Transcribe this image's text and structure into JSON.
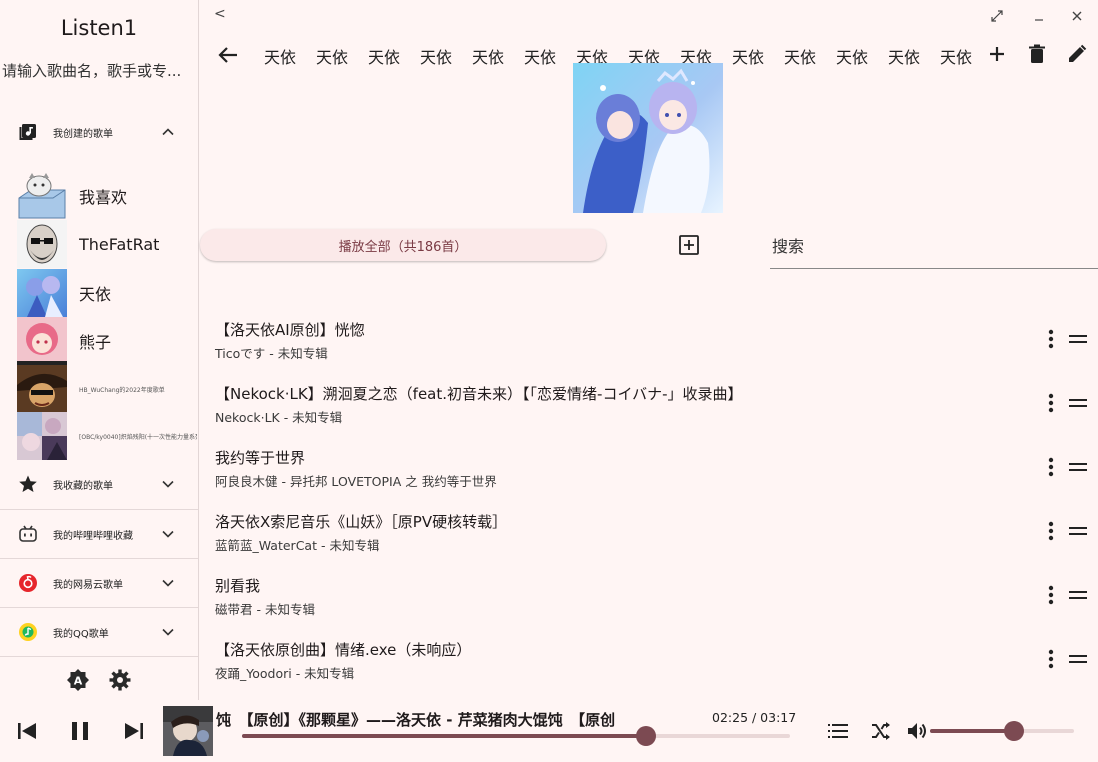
{
  "app": {
    "title": "Listen1"
  },
  "sidebar": {
    "search_placeholder": "请输入歌曲名，歌手或专...",
    "sections": {
      "created": {
        "label": "我创建的歌单",
        "expanded": true
      },
      "favorited": {
        "label": "我收藏的歌单",
        "expanded": false
      },
      "bilibili": {
        "label": "我的哔哩哔哩收藏",
        "expanded": false
      },
      "netease": {
        "label": "我的网易云歌单",
        "expanded": false
      },
      "qq": {
        "label": "我的QQ歌单",
        "expanded": false
      }
    },
    "playlists": [
      {
        "name": "我喜欢"
      },
      {
        "name": "TheFatRat"
      },
      {
        "name": "天依"
      },
      {
        "name": "熊子"
      },
      {
        "name": "HB_WuChang的2022年度歌单"
      },
      {
        "name": "[OBC/ky0040]炽焰残阳(十一次性能力量系列)"
      }
    ]
  },
  "header": {
    "back_label": "<",
    "tags": [
      "天依",
      "天依",
      "天依",
      "天依",
      "天依",
      "天依",
      "天依",
      "天依",
      "天依",
      "天依",
      "天依",
      "天依",
      "天依",
      "天依"
    ]
  },
  "playlist": {
    "play_all_label": "播放全部（共186首）",
    "search_placeholder": "搜索"
  },
  "tracks": [
    {
      "title": "【洛天依AI原创】恍惚",
      "subtitle": "Ticoです - 未知专辑"
    },
    {
      "title": "【Nekock·LK】溯洄夏之恋（feat.初音未来）【「恋爱情绪-コイバナ-」收录曲】",
      "subtitle": "Nekock·LK - 未知专辑"
    },
    {
      "title": "我约等于世界",
      "subtitle": "阿良良木健 - 异托邦 LOVETOPIA 之 我约等于世界"
    },
    {
      "title": "洛天依X索尼音乐《山妖》［原PV硬核转载］",
      "subtitle": "蓝箭蓝_WaterCat - 未知专辑"
    },
    {
      "title": "别看我",
      "subtitle": "磁带君 - 未知专辑"
    },
    {
      "title": "【洛天依原创曲】情绪.exe（未响应）",
      "subtitle": "夜踊_Yoodori - 未知专辑"
    }
  ],
  "player": {
    "now_playing": "饨　【原创】《那颗星》——洛天依 - 芹菜猪肉大馄饨　【原创",
    "current_time": "02:25",
    "total_time": "03:17",
    "time_display": "02:25 / 03:17",
    "progress_fraction": 0.737,
    "volume_fraction": 0.58
  },
  "colors": {
    "background": "#fff5f4",
    "accent": "#7c4a52",
    "track_inactive": "#e9d7d7"
  }
}
